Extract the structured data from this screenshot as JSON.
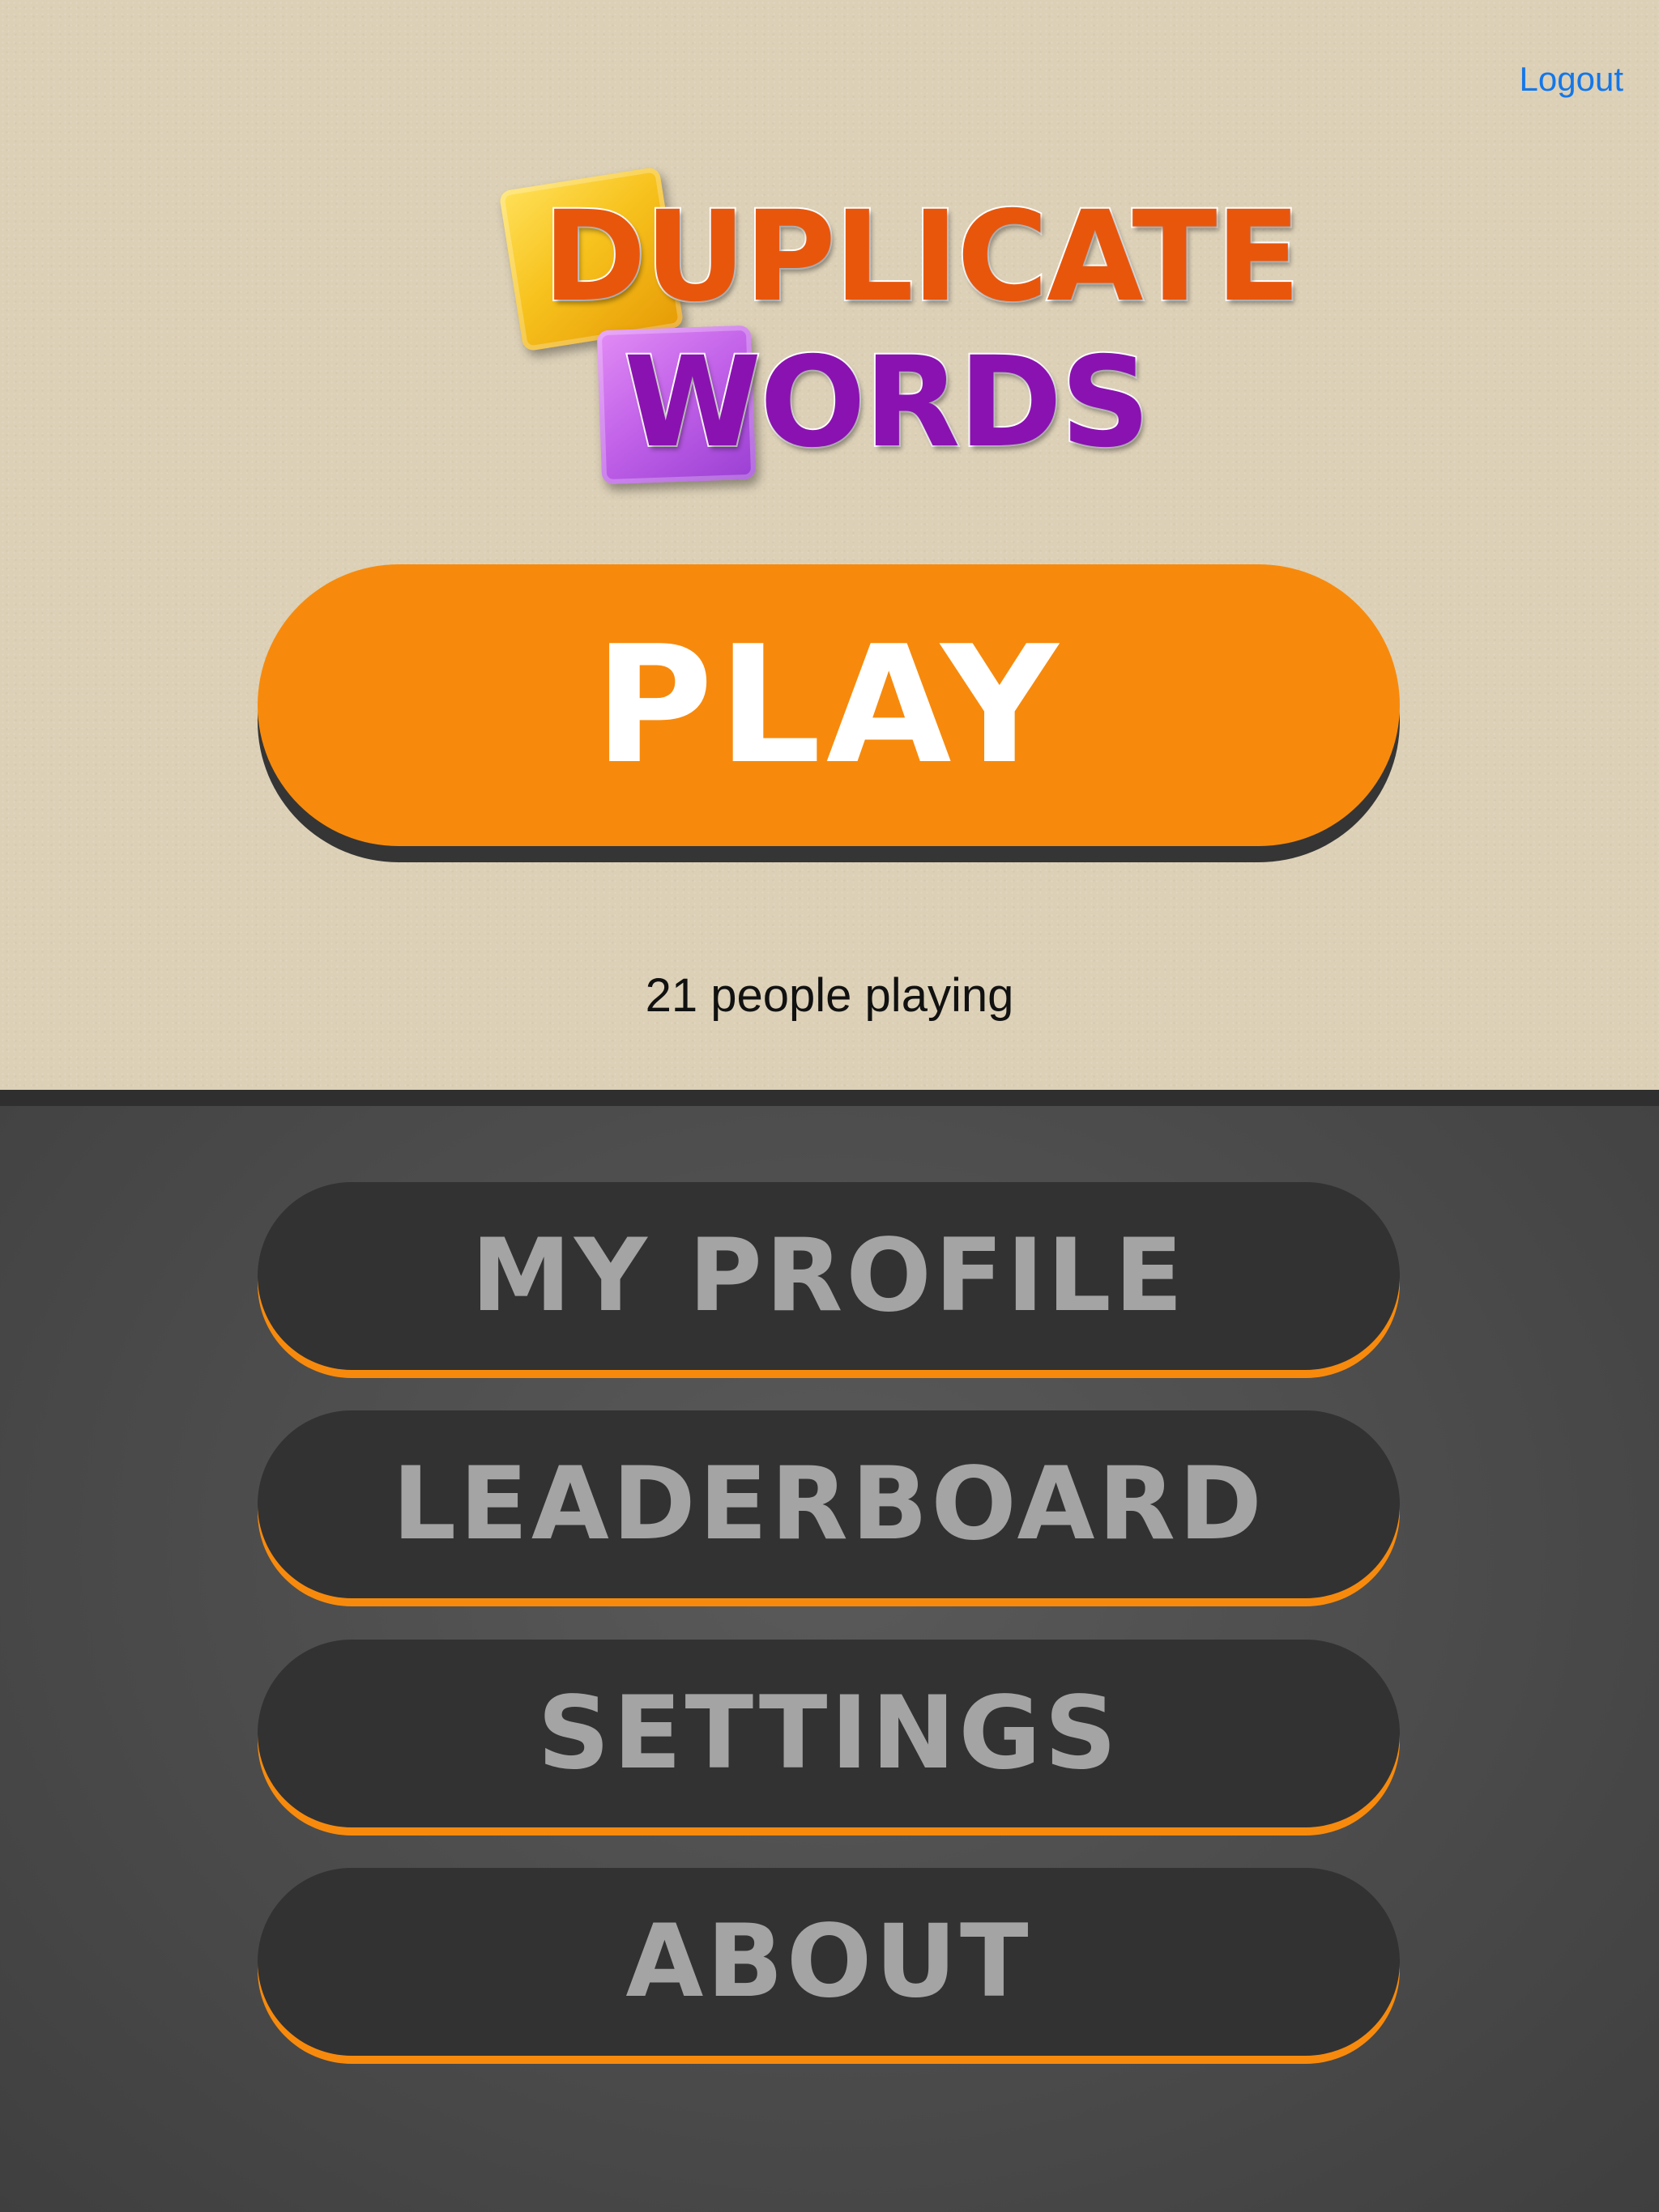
{
  "header": {
    "logout_label": "Logout"
  },
  "logo": {
    "line1": "DUPLICATE",
    "line2": "WORDS"
  },
  "play": {
    "label": "PLAY",
    "players_text": "21 people playing"
  },
  "menu": {
    "profile_label": "MY PROFILE",
    "leaderboard_label": "LEADERBOARD",
    "settings_label": "SETTINGS",
    "about_label": "ABOUT"
  },
  "colors": {
    "top_background": "#dcd0b7",
    "bottom_background": "#4b4b4b",
    "accent_orange": "#f78a0c",
    "menu_button": "#323232",
    "menu_text": "#a4a4a4",
    "link_blue": "#1477e8",
    "logo_orange": "#e8560c",
    "logo_purple": "#8a12b0"
  }
}
